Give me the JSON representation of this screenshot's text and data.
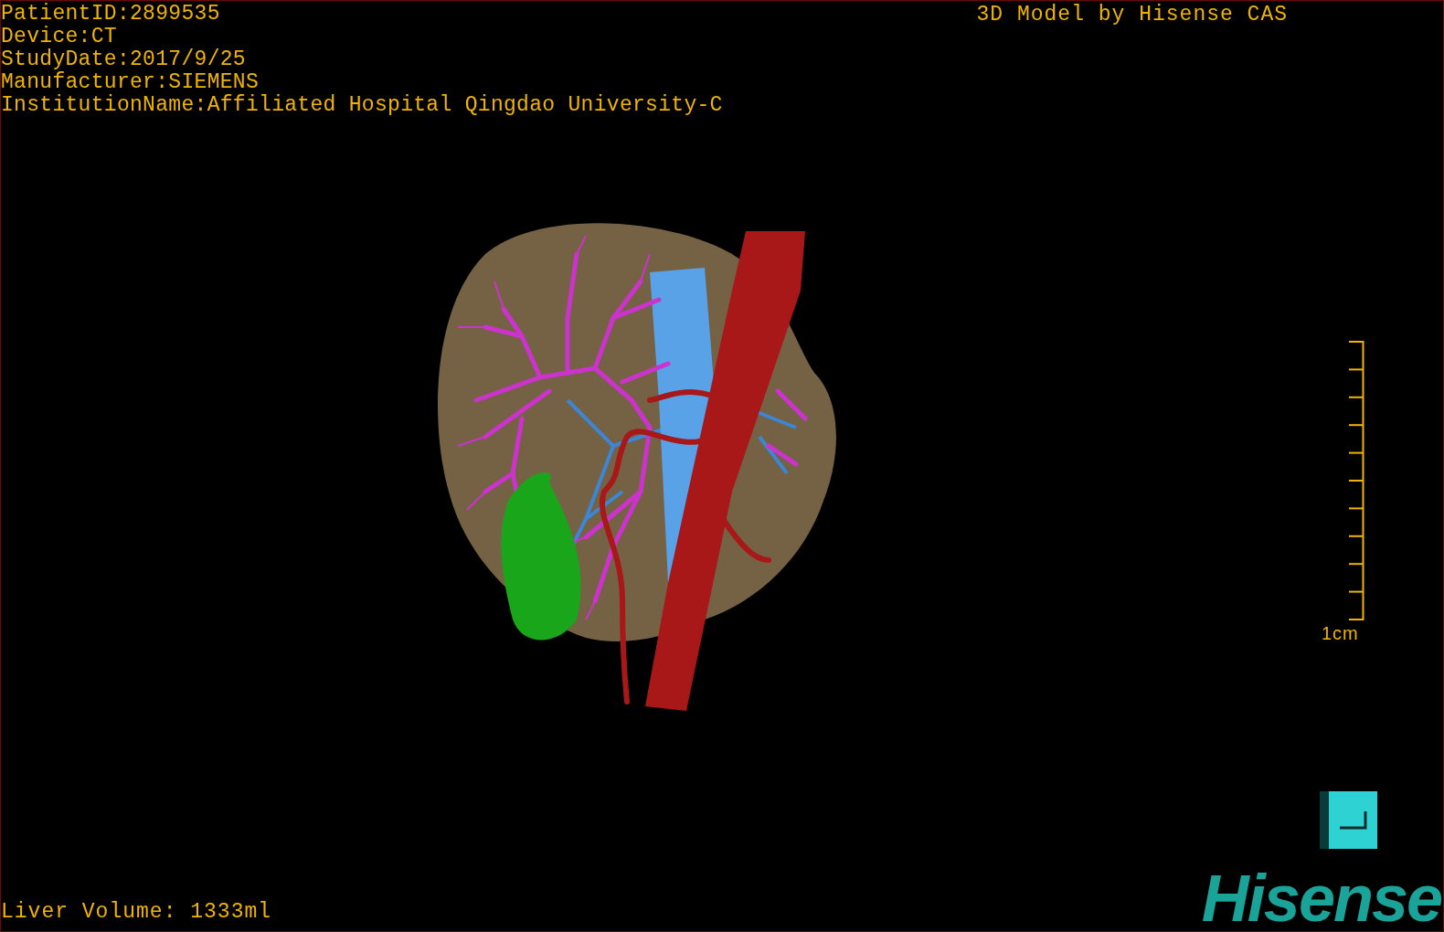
{
  "study_info": [
    "PatientID:2899535",
    "Device:CT",
    "StudyDate:2017/9/25",
    "Manufacturer:SIEMENS",
    "InstitutionName:Affiliated Hospital Qingdao University-C"
  ],
  "title": "3D Model by Hisense CAS",
  "scale_bar": {
    "label": "1cm"
  },
  "liver_volume": "Liver Volume: 1333ml",
  "logo": "Hisense"
}
